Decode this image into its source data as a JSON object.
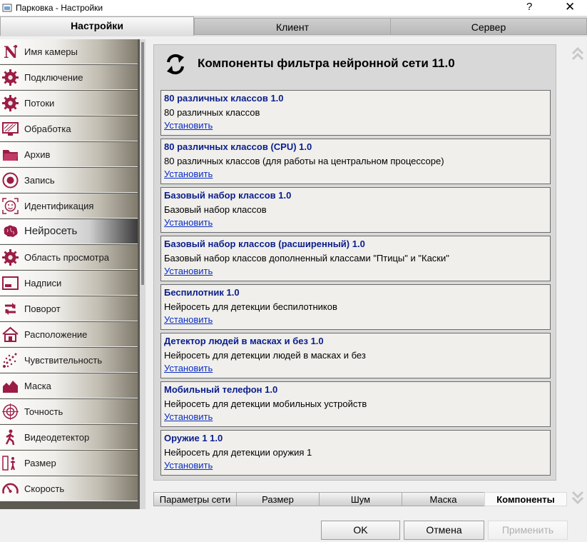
{
  "window": {
    "title": "Парковка - Настройки",
    "help": "?",
    "close": "✕"
  },
  "tabs": [
    {
      "label": "Настройки",
      "active": true
    },
    {
      "label": "Клиент",
      "active": false
    },
    {
      "label": "Сервер",
      "active": false
    }
  ],
  "sidebar": {
    "items": [
      {
        "label": "Имя камеры",
        "icon": "camera-name-icon"
      },
      {
        "label": "Подключение",
        "icon": "gear-icon"
      },
      {
        "label": "Потоки",
        "icon": "gear-icon"
      },
      {
        "label": "Обработка",
        "icon": "monitor-icon"
      },
      {
        "label": "Архив",
        "icon": "folder-icon"
      },
      {
        "label": "Запись",
        "icon": "record-icon"
      },
      {
        "label": "Идентификация",
        "icon": "face-icon"
      },
      {
        "label": "Нейросеть",
        "icon": "brain-icon",
        "active": true
      },
      {
        "label": "Область просмотра",
        "icon": "gear-icon"
      },
      {
        "label": "Надписи",
        "icon": "caption-icon"
      },
      {
        "label": "Поворот",
        "icon": "rotate-icon"
      },
      {
        "label": "Расположение",
        "icon": "house-icon"
      },
      {
        "label": "Чувствительность",
        "icon": "sensitivity-icon"
      },
      {
        "label": "Маска",
        "icon": "mask-icon"
      },
      {
        "label": "Точность",
        "icon": "target-icon"
      },
      {
        "label": "Видеодетектор",
        "icon": "walker-icon"
      },
      {
        "label": "Размер",
        "icon": "size-icon"
      },
      {
        "label": "Скорость",
        "icon": "speedometer-icon"
      }
    ]
  },
  "panel": {
    "title": "Компоненты фильтра нейронной сети 11.0",
    "components": [
      {
        "name": "80 различных классов 1.0",
        "desc": "80 различных классов",
        "link": "Установить"
      },
      {
        "name": "80 различных классов (CPU) 1.0",
        "desc": "80 различных классов (для работы на центральном процессоре)",
        "link": "Установить"
      },
      {
        "name": "Базовый набор классов 1.0",
        "desc": "Базовый набор классов",
        "link": "Установить"
      },
      {
        "name": "Базовый набор классов (расширенный) 1.0",
        "desc": "Базовый набор классов дополненный классами \"Птицы\" и \"Каски\"",
        "link": "Установить"
      },
      {
        "name": "Беспилотник 1.0",
        "desc": "Нейросеть для детекции беспилотников",
        "link": "Установить"
      },
      {
        "name": "Детектор людей в масках и без 1.0",
        "desc": "Нейросеть для детекции людей в масках и без",
        "link": "Установить"
      },
      {
        "name": "Мобильный телефон 1.0",
        "desc": "Нейросеть для детекции мобильных устройств",
        "link": "Установить"
      },
      {
        "name": "Оружие 1 1.0",
        "desc": "Нейросеть для детекции оружия 1",
        "link": "Установить"
      }
    ]
  },
  "bottom_tabs": [
    {
      "label": "Параметры сети",
      "active": false
    },
    {
      "label": "Размер",
      "active": false
    },
    {
      "label": "Шум",
      "active": false
    },
    {
      "label": "Маска",
      "active": false
    },
    {
      "label": "Компоненты",
      "active": true
    }
  ],
  "buttons": {
    "ok": "OK",
    "cancel": "Отмена",
    "apply": "Применить"
  },
  "colors": {
    "accent": "#9b1c45",
    "link": "#0b2ec2",
    "component_title": "#0a1d8c"
  }
}
